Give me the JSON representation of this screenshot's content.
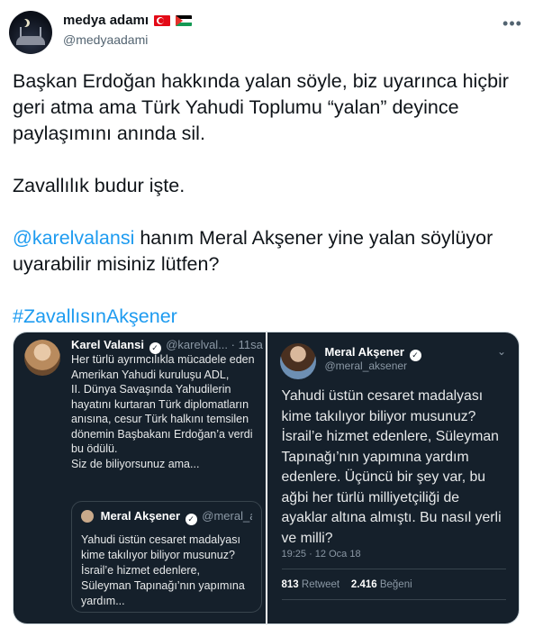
{
  "author": {
    "display_name": "medya adamı",
    "handle": "@medyaadami",
    "flags": [
      "flag-tr-icon",
      "flag-ps-icon"
    ]
  },
  "tweet": {
    "para1": "Başkan Erdoğan hakkında yalan söyle, biz uyarınca hiçbir geri atma ama Türk Yahudi Toplumu “yalan” deyince paylaşımını anında sil.",
    "para2": "Zavallılık budur işte.",
    "mention": "@karelvalansi",
    "para3_rest": " hanım Meral Akşener yine yalan söylüyor uyarabilir misiniz lütfen?",
    "hashtag": "#ZavallısınAkşener"
  },
  "left_panel": {
    "name": "Karel Valansi",
    "handle_time": "@karelval... · 11sa",
    "line1": "Her türlü ayrımcılıkla mücadele eden Amerikan Yahudi kuruluşu ADL,",
    "line2": "II. Dünya Savaşında Yahudilerin hayatını kurtaran Türk diplomatların anısına, cesur Türk halkını temsilen dönemin Başbakanı Erdoğan’a verdi bu ödülü.",
    "line3": "Siz de biliyorsunuz ama...",
    "quote": {
      "name": "Meral Akşener",
      "handle": "@meral_ak...",
      "text": "Yahudi üstün cesaret madalyası kime takılıyor biliyor musunuz? İsrail’e hizmet edenlere, Süleyman Tapınağı’nın yapımına yardım..."
    }
  },
  "right_panel": {
    "name": "Meral Akşener",
    "handle": "@meral_aksener",
    "text": "Yahudi üstün cesaret madalyası kime takılıyor biliyor musunuz? İsrail’e hizmet edenlere, Süleyman Tapınağı’nın yapımına yardım edenlere. Üçüncü bir şey var, bu ağbi her türlü milliyetçiliği de ayaklar altına almıştı. Bu nasıl yerli ve milli?",
    "time": "19:25 · 12 Oca 18",
    "retweets": "813",
    "retweet_label": "Retweet",
    "likes": "2.416",
    "likes_label": "Beğeni"
  },
  "colors": {
    "link": "#1d9bf0",
    "dark_bg": "#15202b",
    "muted": "#536471"
  }
}
